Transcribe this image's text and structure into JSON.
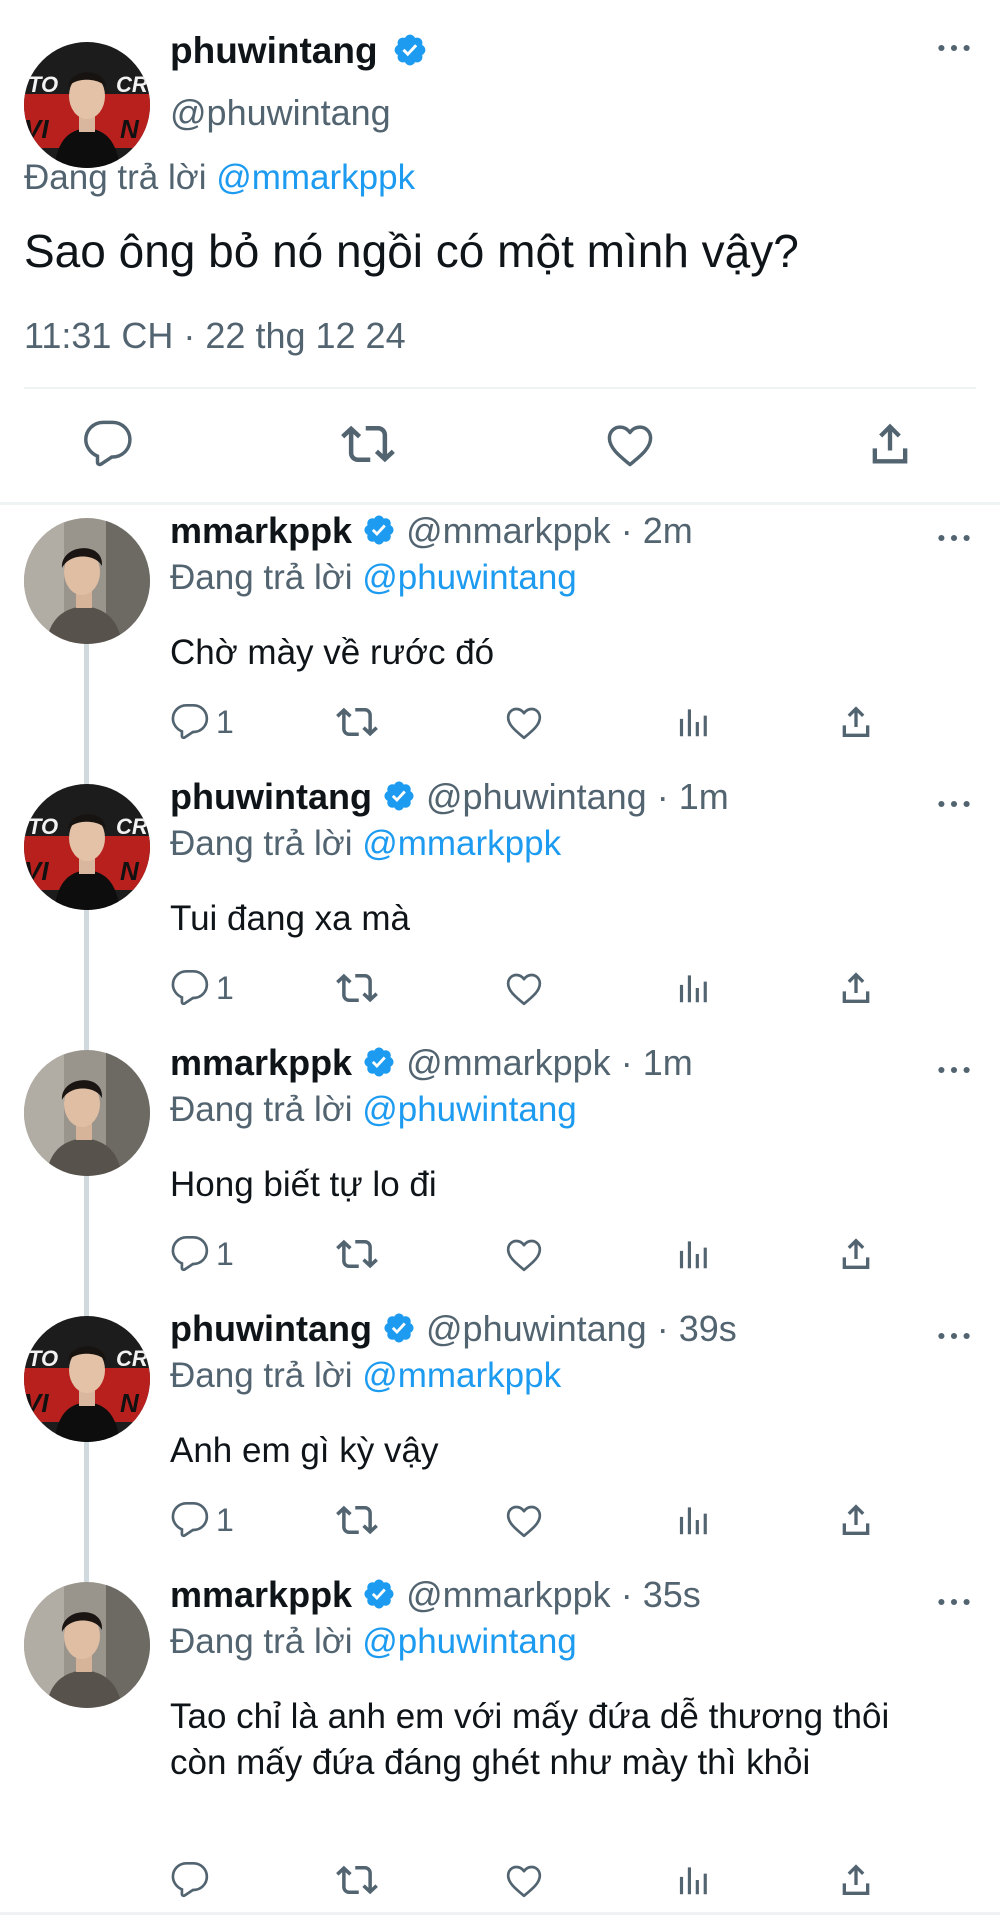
{
  "main": {
    "name": "phuwintang",
    "handle": "@phuwintang",
    "replying_prefix": "Đang trả lời",
    "replying_to": "@mmarkppk",
    "text": "Sao ông bỏ nó ngồi có một mình vậy?",
    "timestamp": "11:31 CH · 22 thg 12 24",
    "actions": [
      "reply-icon",
      "retweet-icon",
      "like-icon",
      "share-icon"
    ]
  },
  "colors": {
    "accent": "#1d9bf0",
    "secondary_text": "#536471",
    "divider": "#eff3f4",
    "thread_line": "#cfd9de"
  },
  "replies": [
    {
      "name": "mmarkppk",
      "handle": "@mmarkppk",
      "time": "· 2m",
      "replying_prefix": "Đang trả lời",
      "replying_to": "@phuwintang",
      "text": "Chờ mày về rước đó",
      "reply_count": "1"
    },
    {
      "name": "phuwintang",
      "handle": "@phuwintang",
      "time": "· 1m",
      "replying_prefix": "Đang trả lời",
      "replying_to": "@mmarkppk",
      "text": "Tui đang xa mà",
      "reply_count": "1"
    },
    {
      "name": "mmarkppk",
      "handle": "@mmarkppk",
      "time": "· 1m",
      "replying_prefix": "Đang trả lời",
      "replying_to": "@phuwintang",
      "text": "Hong biết tự lo đi",
      "reply_count": "1"
    },
    {
      "name": "phuwintang",
      "handle": "@phuwintang",
      "time": "· 39s",
      "replying_prefix": "Đang trả lời",
      "replying_to": "@mmarkppk",
      "text": "Anh em gì kỳ vậy",
      "reply_count": "1"
    },
    {
      "name": "mmarkppk",
      "handle": "@mmarkppk",
      "time": "· 35s",
      "replying_prefix": "Đang trả lời",
      "replying_to": "@phuwintang",
      "text": "Tao chỉ là anh em với mấy đứa dễ thương thôi còn mấy đứa đáng ghét như mày thì khỏi",
      "reply_count": ""
    }
  ]
}
